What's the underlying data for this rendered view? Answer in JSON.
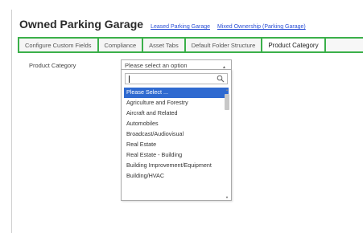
{
  "header": {
    "title": "Owned Parking Garage",
    "links": [
      "Leased Parking Garage",
      "Mixed Ownership (Parking Garage)"
    ]
  },
  "tabs": [
    {
      "label": "Configure Custom Fields",
      "active": false
    },
    {
      "label": "Compliance",
      "active": false
    },
    {
      "label": "Asset Tabs",
      "active": false
    },
    {
      "label": "Default Folder Structure",
      "active": false
    },
    {
      "label": "Product Category",
      "active": true
    }
  ],
  "form": {
    "field_label": "Product Category",
    "select_placeholder": "Please select an option",
    "search_value": ""
  },
  "dropdown": {
    "options": [
      "Please Select ...",
      "Agriculture and Forestry",
      "Aircraft and Related",
      "Automobiles",
      "Broadcast/Audiovisual",
      "Real Estate",
      "Real Estate - Building",
      "Building Improvement/Equipment",
      "Building/HVAC"
    ],
    "highlighted_index": 0
  },
  "colors": {
    "tab_border": "#3bb04a",
    "link": "#2a4fd6",
    "highlight": "#2f6ad0"
  }
}
